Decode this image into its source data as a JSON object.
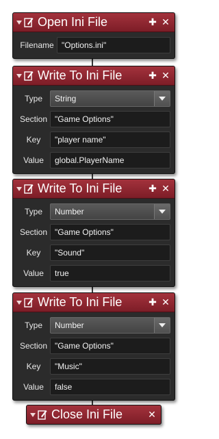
{
  "open": {
    "title": "Open Ini File",
    "filename_label": "Filename",
    "filename_value": "\"Options.ini\""
  },
  "writes": [
    {
      "title": "Write To Ini File",
      "type_label": "Type",
      "type_value": "String",
      "section_label": "Section",
      "section_value": "\"Game Options\"",
      "key_label": "Key",
      "key_value": "\"player name\"",
      "value_label": "Value",
      "value_value": "global.PlayerName"
    },
    {
      "title": "Write To Ini File",
      "type_label": "Type",
      "type_value": "Number",
      "section_label": "Section",
      "section_value": "\"Game Options\"",
      "key_label": "Key",
      "key_value": "\"Sound\"",
      "value_label": "Value",
      "value_value": "true"
    },
    {
      "title": "Write To Ini File",
      "type_label": "Type",
      "type_value": "Number",
      "section_label": "Section",
      "section_value": "\"Game Options\"",
      "key_label": "Key",
      "key_value": "\"Music\"",
      "value_label": "Value",
      "value_value": "false"
    }
  ],
  "close": {
    "title": "Close Ini File"
  },
  "controls": {
    "pin_glyph": "✚",
    "close_glyph": "✕"
  },
  "icons": {
    "collapse": "triangle-down-icon",
    "action": "file-pencil-icon",
    "pin": "pin-icon",
    "close": "close-icon",
    "dropdown": "chevron-down-icon"
  },
  "colors": {
    "header": "#8e2530",
    "panel": "#2b2b2b",
    "field": "#1c1c1c"
  }
}
